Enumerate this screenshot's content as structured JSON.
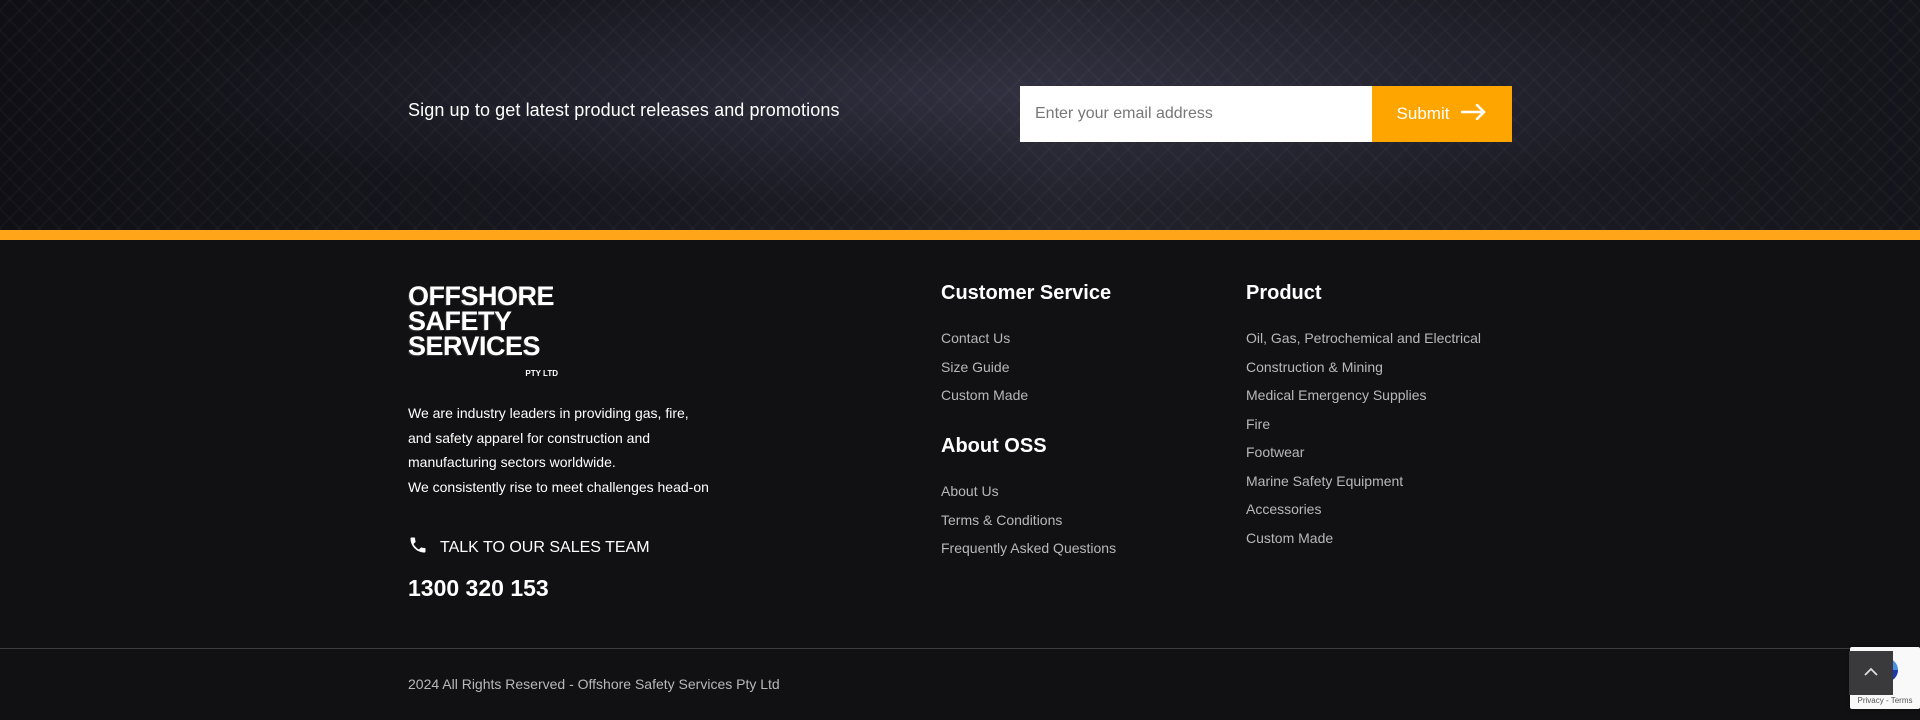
{
  "newsletter": {
    "label": "Sign up to get latest product releases and promotions",
    "email_placeholder": "Enter your email address",
    "submit_label": "Submit",
    "submit_icon": "arrow-right-icon"
  },
  "colors": {
    "accent": "#ffa500",
    "footer_bg": "#111113",
    "link": "#b8b8bc"
  },
  "brand": {
    "logo_lines": [
      "OFFSHORE",
      "SAFETY",
      "SERVICES"
    ],
    "logo_suffix": "PTY LTD"
  },
  "about": {
    "lines": [
      "We are industry leaders in providing gas, fire,",
      "and safety apparel for construction and",
      "manufacturing sectors worldwide.",
      "We consistently rise to meet challenges head-on"
    ]
  },
  "sales": {
    "icon": "phone-icon",
    "label": "TALK TO OUR SALES TEAM",
    "phone": "1300 320 153"
  },
  "customer_service": {
    "title": "Customer Service",
    "items": [
      "Contact Us",
      "Size Guide",
      "Custom Made"
    ]
  },
  "about_oss": {
    "title": "About OSS",
    "items": [
      "About Us",
      "Terms & Conditions",
      "Frequently Asked Questions"
    ]
  },
  "product": {
    "title": "Product",
    "items": [
      "Oil, Gas, Petrochemical and Electrical",
      "Construction & Mining",
      "Medical Emergency Supplies",
      "Fire",
      "Footwear",
      "Marine Safety Equipment",
      "Accessories",
      "Custom Made"
    ]
  },
  "copyright": "2024 All Rights Reserved - Offshore Safety Services Pty Ltd",
  "recaptcha": {
    "icon": "recaptcha-icon",
    "text": "Privacy - Terms"
  },
  "scroll_top_icon": "chevron-up-icon"
}
